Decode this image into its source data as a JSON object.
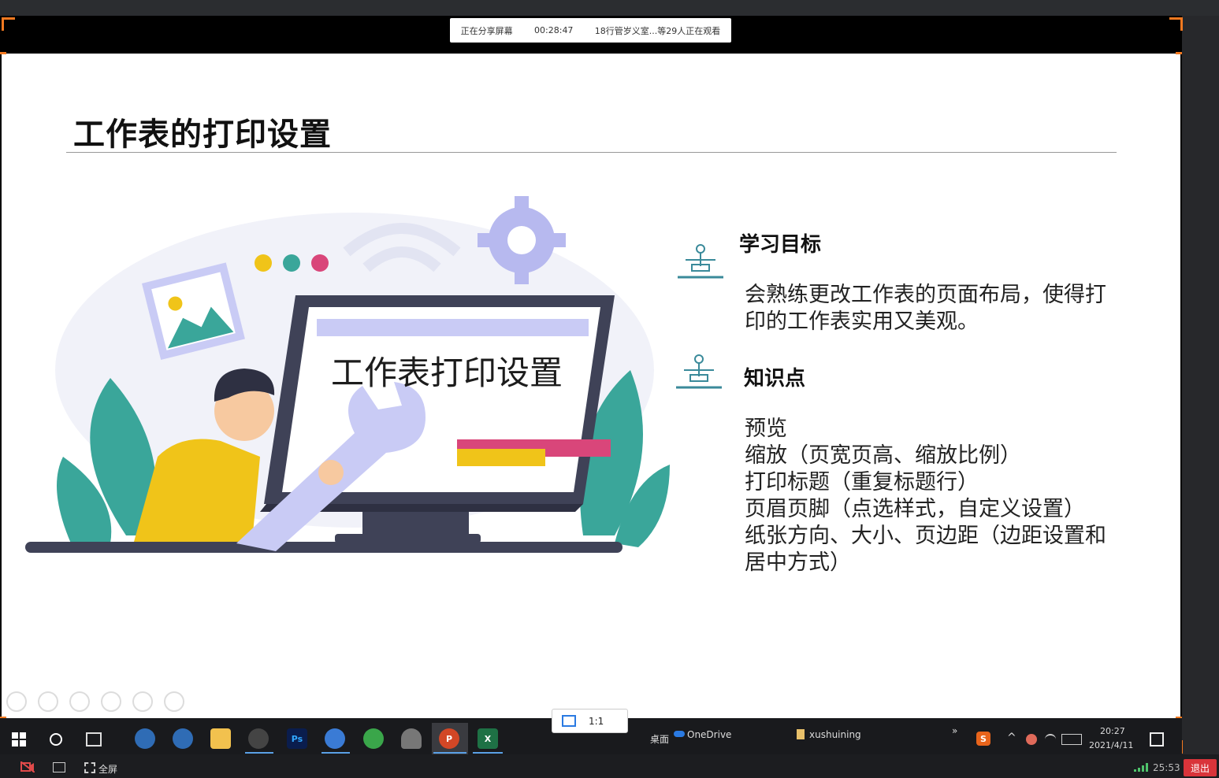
{
  "share_banner": {
    "status": "正在分享屏幕",
    "elapsed": "00:28:47",
    "viewers": "18行管岁义室...等29人正在观看"
  },
  "slide": {
    "title": "工作表的打印设置",
    "screen_text": "工作表打印设置",
    "goal": {
      "heading": "学习目标",
      "text": "会熟练更改工作表的页面布局，使得打印的工作表实用又美观。"
    },
    "knowledge": {
      "heading": "知识点",
      "items": [
        "预览",
        "缩放（页宽页高、缩放比例）",
        "打印标题（重复标题行）",
        "页眉页脚（点选样式，自定义设置）",
        "纸张方向、大小、页边距（边距设置和居中方式）"
      ]
    }
  },
  "ratio_popup": {
    "label": "1:1"
  },
  "taskbar": {
    "desktop_label": "桌面",
    "onedrive_label": "OneDrive",
    "user_label": "xushuining",
    "overflow_label": "»",
    "time": "20:27",
    "date": "2021/4/11"
  },
  "meeting_bar": {
    "fullscreen_label": "全屏",
    "duration": "25:53",
    "exit_label": "退出"
  },
  "colors": {
    "accent_orange": "#f47920",
    "teal": "#3aa69a",
    "exit_red": "#d9343a"
  }
}
